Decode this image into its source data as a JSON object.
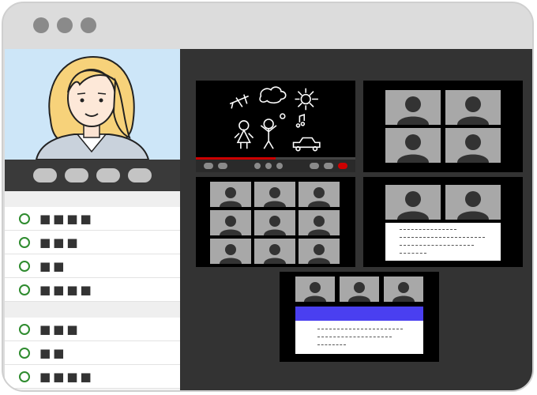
{
  "window": {
    "controls": [
      "close-dot",
      "minimize-dot",
      "maximize-dot"
    ]
  },
  "sidebar": {
    "self_video": {
      "participant": "woman-avatar"
    },
    "control_buttons": [
      "control-1",
      "control-2",
      "control-3",
      "control-4"
    ],
    "groups": [
      {
        "items": [
          {
            "label": "■■■■"
          },
          {
            "label": "■■■"
          },
          {
            "label": "■■"
          },
          {
            "label": "■■■■"
          }
        ]
      },
      {
        "items": [
          {
            "label": "■■■"
          },
          {
            "label": "■■"
          },
          {
            "label": "■■■■"
          }
        ]
      }
    ]
  },
  "stage": {
    "featured_video": {
      "content": "kids-chalk-drawing",
      "progress": 0.5
    },
    "grid_2x2": {
      "participants": 4
    },
    "grid_3x3": {
      "participants": 9
    },
    "grid_notes": {
      "participants": 2,
      "note_lines": 4
    },
    "grid_notes_2": {
      "participants": 3,
      "banner_color": "#4a3ff0",
      "note_lines": 3
    }
  },
  "colors": {
    "accent": "#cc0000",
    "status": "#2e8b2e",
    "banner": "#4a3ff0"
  }
}
